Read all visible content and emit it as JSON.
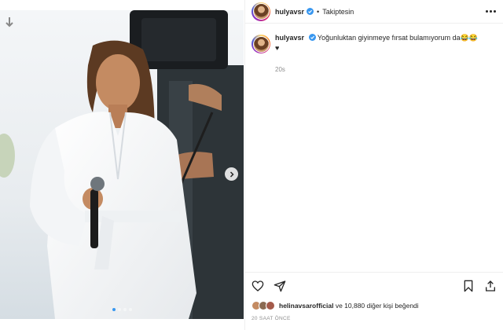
{
  "post": {
    "username": "hulyavsr",
    "follow_status": "Takiptesin",
    "separator": "•",
    "caption": "Yoğunluktan giyinmeye fırsat bulamıyorum da😂😂",
    "caption_line2": "♥",
    "caption_time": "20s",
    "likes_user": "helinavsarofficial",
    "likes_rest": " ve 10,880 diğer kişi beğendi",
    "posted_time": "20 SAAT ÖNCE"
  },
  "media": {
    "carousel_count": 4,
    "active_index": 0
  },
  "icons": {
    "download": "download-arrow-icon",
    "next": "chevron-right-icon",
    "verified": "verified-badge-icon",
    "more": "more-options-icon",
    "like": "heart-icon",
    "share": "paper-plane-icon",
    "save": "bookmark-icon",
    "share_alt": "share-arrow-icon"
  },
  "colors": {
    "verified": "#3897f0",
    "text": "#262626",
    "muted": "#8e8e8e"
  }
}
